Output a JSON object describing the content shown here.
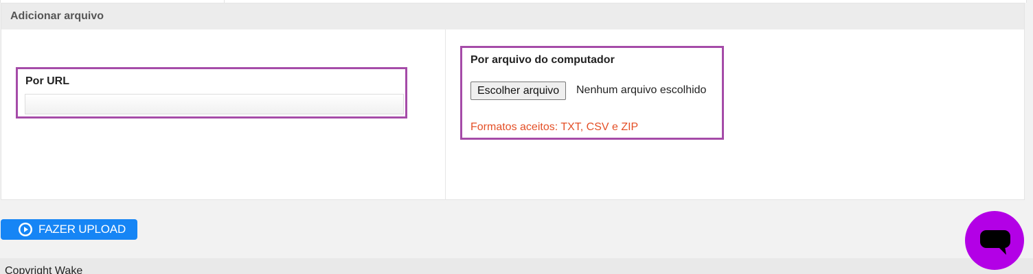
{
  "panel": {
    "title": "Adicionar arquivo"
  },
  "url_section": {
    "label": "Por URL",
    "value": "",
    "placeholder": ""
  },
  "file_section": {
    "label": "Por arquivo do computador",
    "button_label": "Escolher arquivo",
    "status": "Nenhum arquivo escolhido",
    "formats": "Formatos aceitos: TXT, CSV e ZIP"
  },
  "upload_button": {
    "label": "FAZER UPLOAD",
    "icon": "play-circle-icon"
  },
  "footer": {
    "copyright": "Copyright Wake"
  },
  "chat_widget": {
    "icon": "chat-bubble-icon"
  },
  "colors": {
    "highlight_border": "#a54ba8",
    "formats_text": "#e44f26",
    "upload_button_bg": "#1685f5",
    "chat_bubble_bg": "#b300e6"
  }
}
